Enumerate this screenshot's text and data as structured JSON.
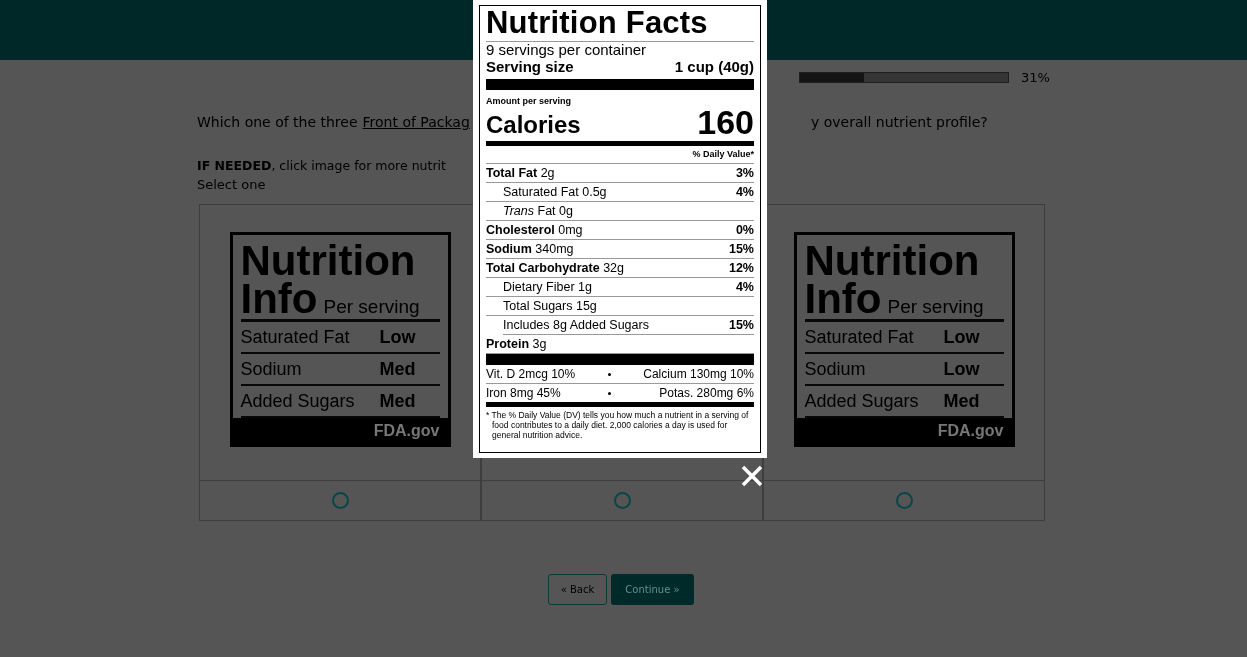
{
  "progress": {
    "level": 0.31,
    "reading": "31%"
  },
  "question": {
    "text_before": "Which one of the three",
    "link": "Front of Packag",
    "text_after": "y overall nutrient profile?"
  },
  "hint": "**IF NEEDED**, click image for more nutrit",
  "instruction": "Select one",
  "options": [
    {
      "kind": "label",
      "title": "Nutrition",
      "subtitle": "Info",
      "per": "Per serving",
      "rows": [
        {
          "nutrient": "Saturated Fat",
          "level": "Low"
        },
        {
          "nutrient": "Sodium",
          "level": "Med"
        },
        {
          "nutrient": "Added Sugars",
          "level": "Med"
        }
      ],
      "source": "FDA.gov",
      "selected": false
    },
    {
      "kind": "covered",
      "selected": false
    },
    {
      "kind": "label",
      "title": "Nutrition",
      "subtitle": "Info",
      "per": "Per serving",
      "rows": [
        {
          "nutrient": "Saturated Fat",
          "level": "Low"
        },
        {
          "nutrient": "Sodium",
          "level": "Low"
        },
        {
          "nutrient": "Added Sugars",
          "level": "Med"
        }
      ],
      "source": "FDA.gov",
      "selected": false
    }
  ],
  "buttons": {
    "back": "« Back",
    "continue": "Continue »"
  },
  "modal": {
    "title": "Nutrition Facts",
    "servings": "9 servings per container",
    "serving_size_label": "Serving size",
    "serving_size_value": "1 cup (40g)",
    "amount_label": "Amount per serving",
    "calories_label": "Calories",
    "calories_value": "160",
    "dv_header": "% Daily Value*",
    "rows": [
      {
        "kind": "main",
        "name": "Total Fat",
        "amount": "2g",
        "dv": "3%"
      },
      {
        "kind": "sub",
        "name": "Saturated Fat",
        "amount": "0.5g",
        "dv": "4%"
      },
      {
        "kind": "sub",
        "name": "*Trans* Fat",
        "amount": "0g"
      },
      {
        "kind": "main",
        "name": "Cholesterol",
        "amount": "0mg",
        "dv": "0%"
      },
      {
        "kind": "main",
        "name": "Sodium",
        "amount": "340mg",
        "dv": "15%"
      },
      {
        "kind": "main",
        "name": "Total Carbohydrate",
        "amount": "32g",
        "dv": "12%"
      },
      {
        "kind": "sub",
        "name": "Dietary Fiber",
        "amount": "1g",
        "dv": "4%"
      },
      {
        "kind": "sub",
        "name": "Total Sugars",
        "amount": "15g"
      },
      {
        "kind": "subsub",
        "name": "Includes 8g Added Sugars",
        "dv": "15%"
      },
      {
        "kind": "main",
        "name": "Protein",
        "amount": "3g"
      }
    ],
    "vitamins": [
      {
        "left": "Vit. D 2mcg 10%",
        "right": "Calcium 130mg 10%"
      },
      {
        "left": "Iron 8mg 45%",
        "right": "Potas. 280mg 6%"
      }
    ],
    "footnote": "* The % Daily Value (DV) tells you how much a nutrient in a serving of food contributes to a daily diet. 2,000 calories a day is used for general nutrition advice."
  }
}
